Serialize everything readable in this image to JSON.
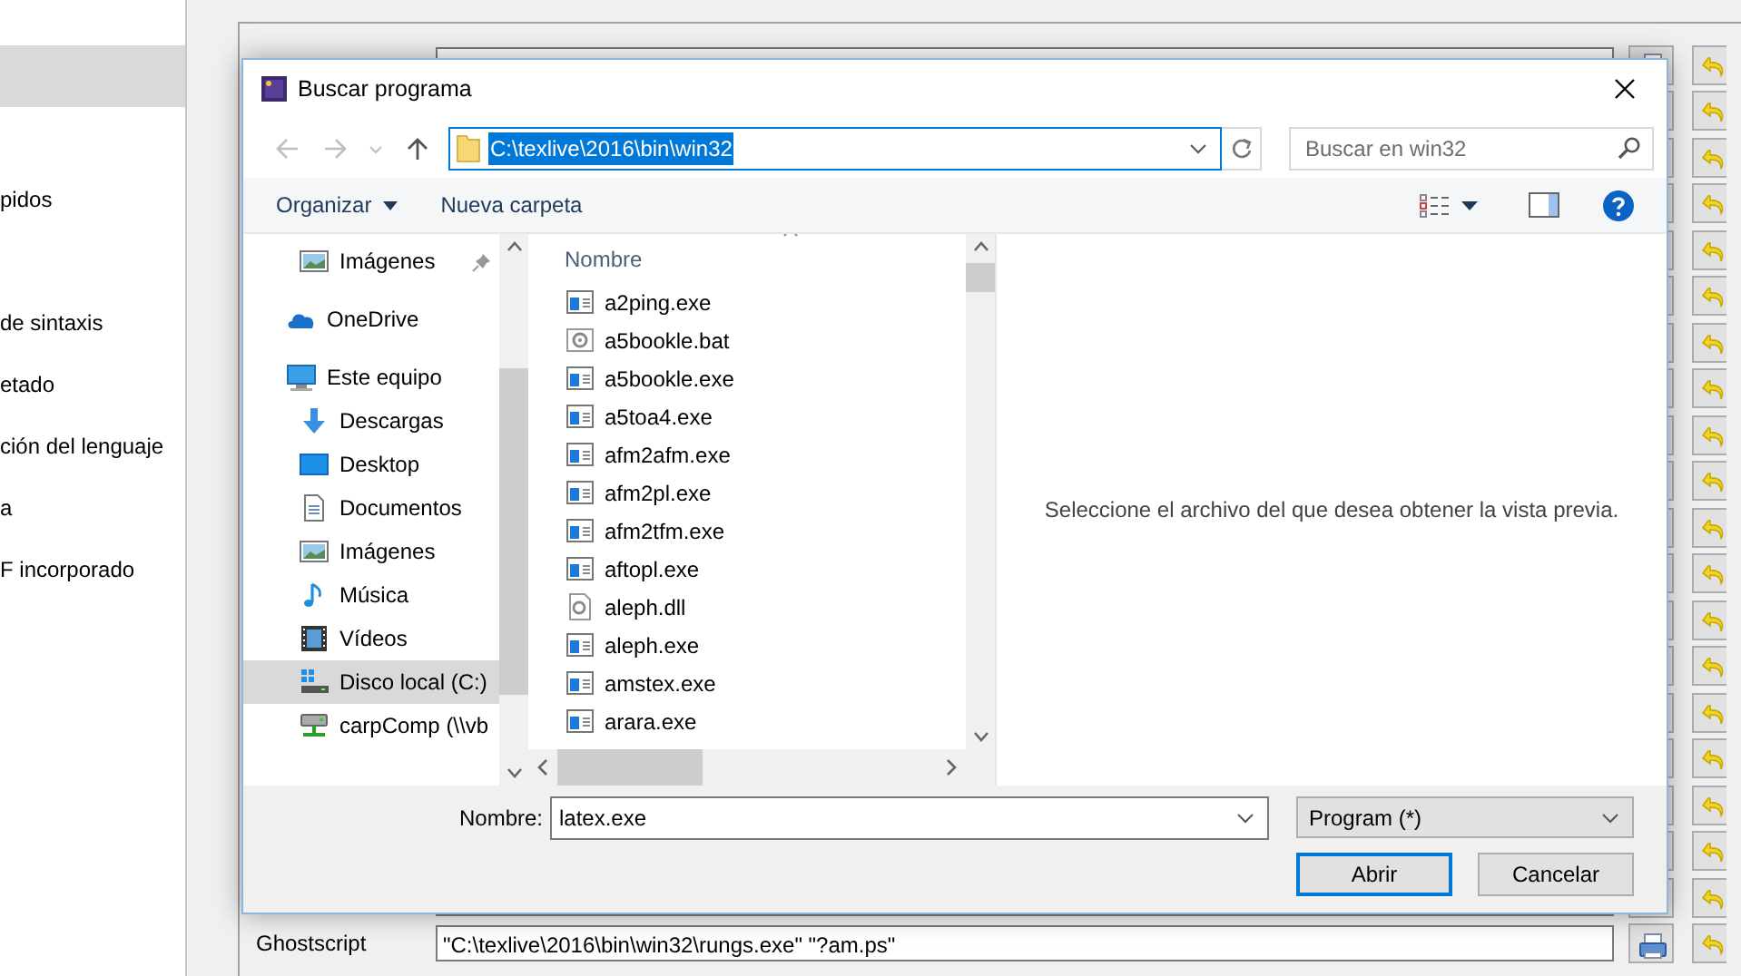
{
  "sidebar": {
    "items": [
      {
        "kind": "blank",
        "selected": true
      },
      {
        "kind": "spacer"
      },
      {
        "kind": "text",
        "text": "pidos",
        "selected": false
      },
      {
        "kind": "spacer"
      },
      {
        "kind": "text",
        "text": "de sintaxis",
        "selected": false
      },
      {
        "kind": "text",
        "text": "etado",
        "selected": false
      },
      {
        "kind": "text",
        "text": "ción del lenguaje",
        "selected": false
      },
      {
        "kind": "text",
        "text": "a",
        "selected": false
      },
      {
        "kind": "text",
        "text": "F incorporado",
        "selected": false
      }
    ]
  },
  "tool_rows": [
    {
      "kind": "field"
    },
    {
      "kind": "buttons"
    },
    {
      "kind": "buttons"
    },
    {
      "kind": "buttons"
    },
    {
      "kind": "buttons"
    },
    {
      "kind": "buttons"
    },
    {
      "kind": "buttons"
    },
    {
      "kind": "buttons"
    },
    {
      "kind": "buttons"
    },
    {
      "kind": "buttons"
    },
    {
      "kind": "buttons"
    },
    {
      "kind": "buttons"
    },
    {
      "kind": "buttons"
    },
    {
      "kind": "buttons"
    },
    {
      "kind": "buttons"
    },
    {
      "kind": "buttons"
    },
    {
      "kind": "buttons"
    },
    {
      "kind": "buttons"
    },
    {
      "kind": "field"
    },
    {
      "kind": "filled",
      "label": "Ghostscript",
      "value": "\"C:\\texlive\\2016\\bin\\win32\\rungs.exe\" \"?am.ps\""
    }
  ],
  "dialog": {
    "title": "Buscar programa",
    "address": {
      "path": "C:\\texlive\\2016\\bin\\win32",
      "selected": true
    },
    "search": {
      "placeholder": "Buscar en win32"
    },
    "toolbar": {
      "organize": "Organizar",
      "new_folder": "Nueva carpeta"
    },
    "nav_pane": [
      {
        "kind": "pictures",
        "label": "Imágenes",
        "pinned": true,
        "selected": false
      },
      {
        "kind": "cloud",
        "label": "OneDrive",
        "pinned": false,
        "selected": false
      },
      {
        "kind": "pc",
        "label": "Este equipo",
        "pinned": false,
        "selected": false
      },
      {
        "kind": "download",
        "label": "Descargas",
        "pinned": false,
        "selected": false
      },
      {
        "kind": "desktop",
        "label": "Desktop",
        "pinned": false,
        "selected": false
      },
      {
        "kind": "document",
        "label": "Documentos",
        "pinned": false,
        "selected": false
      },
      {
        "kind": "pictures",
        "label": "Imágenes",
        "pinned": false,
        "selected": false
      },
      {
        "kind": "music",
        "label": "Música",
        "pinned": false,
        "selected": false
      },
      {
        "kind": "video",
        "label": "Vídeos",
        "pinned": false,
        "selected": false
      },
      {
        "kind": "drive",
        "label": "Disco local (C:)",
        "pinned": false,
        "selected": true
      },
      {
        "kind": "netdrive",
        "label": "carpComp (\\\\vb",
        "pinned": false,
        "selected": false
      }
    ],
    "column_header": "Nombre",
    "files": [
      {
        "kind": "exe",
        "name": "a2ping.exe"
      },
      {
        "kind": "bat",
        "name": "a5bookle.bat"
      },
      {
        "kind": "exe",
        "name": "a5bookle.exe"
      },
      {
        "kind": "exe",
        "name": "a5toa4.exe"
      },
      {
        "kind": "exe",
        "name": "afm2afm.exe"
      },
      {
        "kind": "exe",
        "name": "afm2pl.exe"
      },
      {
        "kind": "exe",
        "name": "afm2tfm.exe"
      },
      {
        "kind": "exe",
        "name": "aftopl.exe"
      },
      {
        "kind": "dll",
        "name": "aleph.dll"
      },
      {
        "kind": "exe",
        "name": "aleph.exe"
      },
      {
        "kind": "exe",
        "name": "amstex.exe"
      },
      {
        "kind": "exe",
        "name": "arara.exe"
      }
    ],
    "preview_message": "Seleccione el archivo del que desea obtener la vista previa.",
    "filename_label": "Nombre:",
    "filename": "latex.exe",
    "filter": "Program  (*)",
    "buttons": [
      {
        "label": "Abrir",
        "default": true
      },
      {
        "label": "Cancelar",
        "default": false
      }
    ]
  }
}
